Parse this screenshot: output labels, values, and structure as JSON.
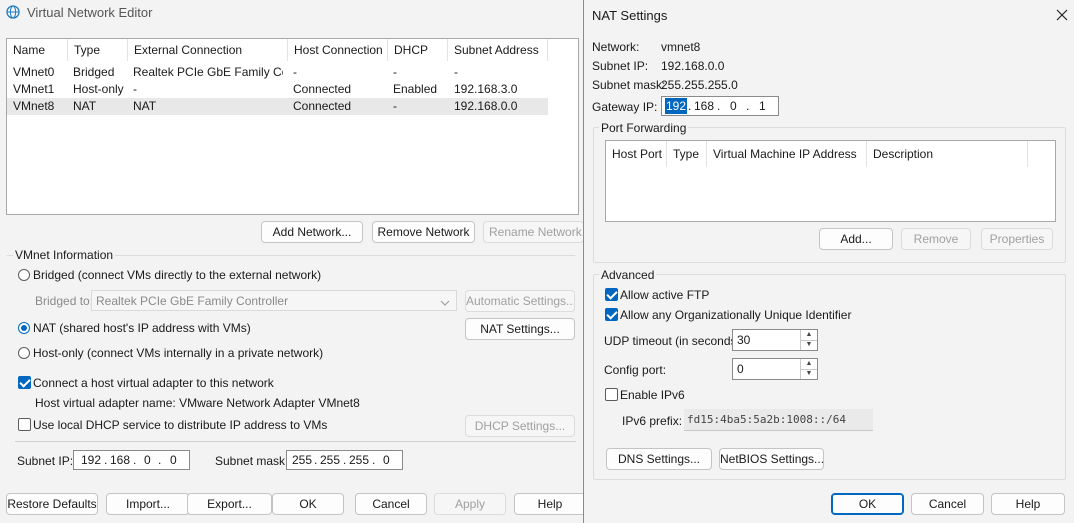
{
  "main_dialog": {
    "title": "Virtual Network Editor",
    "columns": [
      "Name",
      "Type",
      "External Connection",
      "Host Connection",
      "DHCP",
      "Subnet Address"
    ],
    "networks": [
      {
        "name": "VMnet0",
        "type": "Bridged",
        "external": "Realtek PCIe GbE Family Co...",
        "host": "-",
        "dhcp": "-",
        "subnet": "-"
      },
      {
        "name": "VMnet1",
        "type": "Host-only",
        "external": "-",
        "host": "Connected",
        "dhcp": "Enabled",
        "subnet": "192.168.3.0"
      },
      {
        "name": "VMnet8",
        "type": "NAT",
        "external": "NAT",
        "host": "Connected",
        "dhcp": "-",
        "subnet": "192.168.0.0"
      }
    ],
    "add_network": "Add Network...",
    "remove_network": "Remove Network",
    "rename_network": "Rename Network...",
    "info_title": "VMnet Information",
    "bridged_label": "Bridged (connect VMs directly to the external network)",
    "bridged_to_label": "Bridged to:",
    "bridged_to_value": "Realtek PCIe GbE Family Controller",
    "automatic_settings": "Automatic Settings...",
    "nat_label": "NAT (shared host's IP address with VMs)",
    "nat_settings": "NAT Settings...",
    "hostonly_label": "Host-only (connect VMs internally in a private network)",
    "connect_adapter_label": "Connect a host virtual adapter to this network",
    "adapter_name_label": "Host virtual adapter name: VMware Network Adapter VMnet8",
    "dhcp_label": "Use local DHCP service to distribute IP address to VMs",
    "dhcp_settings": "DHCP Settings...",
    "subnet_ip_label": "Subnet IP:",
    "subnet_ip": [
      "192",
      "168",
      "0",
      "0"
    ],
    "subnet_mask_label": "Subnet mask:",
    "subnet_mask": [
      "255",
      "255",
      "255",
      "0"
    ],
    "restore_defaults": "Restore Defaults",
    "import": "Import...",
    "export": "Export...",
    "ok": "OK",
    "cancel": "Cancel",
    "apply": "Apply",
    "help": "Help"
  },
  "nat_dialog": {
    "title": "NAT Settings",
    "network_label": "Network:",
    "network_value": "vmnet8",
    "subnet_ip_label": "Subnet IP:",
    "subnet_ip_value": "192.168.0.0",
    "subnet_mask_label": "Subnet mask:",
    "subnet_mask_value": "255.255.255.0",
    "gateway_label": "Gateway IP:",
    "gateway_ip": [
      "192",
      "168",
      "0",
      "1"
    ],
    "port_forwarding_title": "Port Forwarding",
    "pf_columns": [
      "Host Port",
      "Type",
      "Virtual Machine IP Address",
      "Description"
    ],
    "add": "Add...",
    "remove": "Remove",
    "properties": "Properties",
    "advanced_title": "Advanced",
    "allow_ftp": "Allow active FTP",
    "allow_oui": "Allow any Organizationally Unique Identifier",
    "udp_timeout_label": "UDP timeout (in seconds):",
    "udp_timeout_value": "30",
    "config_port_label": "Config port:",
    "config_port_value": "0",
    "enable_ipv6": "Enable IPv6",
    "ipv6_prefix_label": "IPv6 prefix:",
    "ipv6_prefix_value": "fd15:4ba5:5a2b:1008::/64",
    "dns_settings": "DNS Settings...",
    "netbios_settings": "NetBIOS Settings...",
    "ok": "OK",
    "cancel": "Cancel",
    "help": "Help"
  }
}
